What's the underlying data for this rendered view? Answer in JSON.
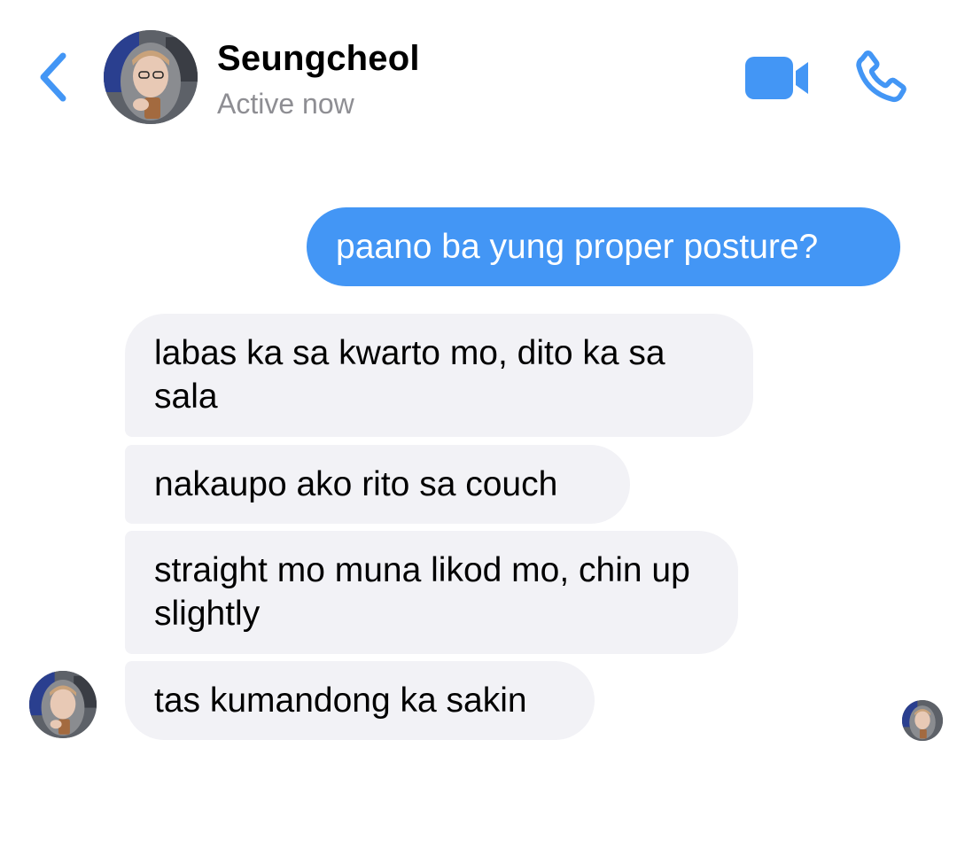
{
  "header": {
    "back_icon": "chevron-left-icon",
    "contact_name": "Seungcheol",
    "status": "Active now",
    "video_icon": "video-camera-icon",
    "call_icon": "phone-icon",
    "accent_color": "#4396f5"
  },
  "messages": [
    {
      "direction": "outgoing",
      "text": "paano ba yung proper posture?"
    },
    {
      "direction": "incoming",
      "text": "labas ka sa kwarto mo, dito ka sa sala"
    },
    {
      "direction": "incoming",
      "text": "nakaupo ako rito sa couch"
    },
    {
      "direction": "incoming",
      "text": "straight mo muna likod mo, chin up slightly"
    },
    {
      "direction": "incoming",
      "text": "tas kumandong ka sakin"
    }
  ],
  "colors": {
    "outgoing_bubble": "#4396f5",
    "incoming_bubble": "#f2f2f6",
    "status_text": "#8e8e93"
  }
}
